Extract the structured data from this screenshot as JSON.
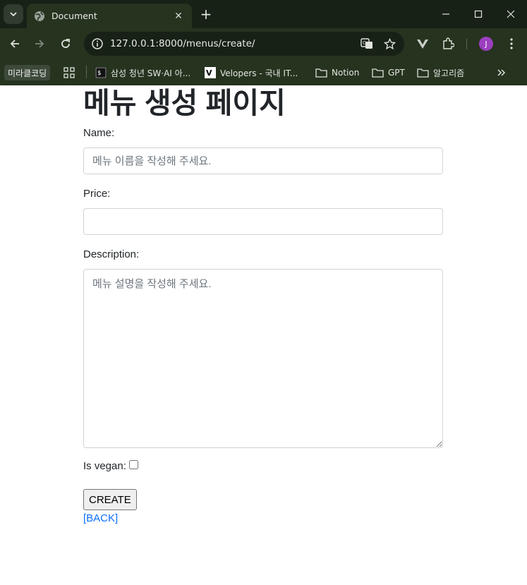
{
  "browser": {
    "tab_title": "Document",
    "url_host": "127.0.0.1",
    "url_rest": ":8000/menus/create/",
    "profile_initial": "J",
    "bookmarks": [
      {
        "label": "미라클코딩"
      },
      {
        "label": "삼성 청년 SW·AI 아..."
      },
      {
        "label": "Velopers - 국내 IT..."
      },
      {
        "label": "Notion"
      },
      {
        "label": "GPT"
      },
      {
        "label": "알고리즘"
      }
    ]
  },
  "page": {
    "heading": "메뉴 생성 페이지",
    "name_label": "Name:",
    "name_placeholder": "메뉴 이름을 작성해 주세요.",
    "name_value": "",
    "price_label": "Price:",
    "price_value": "",
    "description_label": "Description:",
    "description_placeholder": "메뉴 설명을 작성해 주세요.",
    "vegan_label": "Is vegan:",
    "vegan_checked": false,
    "create_button": "CREATE",
    "back_link": "[BACK]"
  },
  "colors": {
    "link": "#0d6efd",
    "chrome_bg": "#26331f",
    "avatar": "#9b3fbf"
  }
}
